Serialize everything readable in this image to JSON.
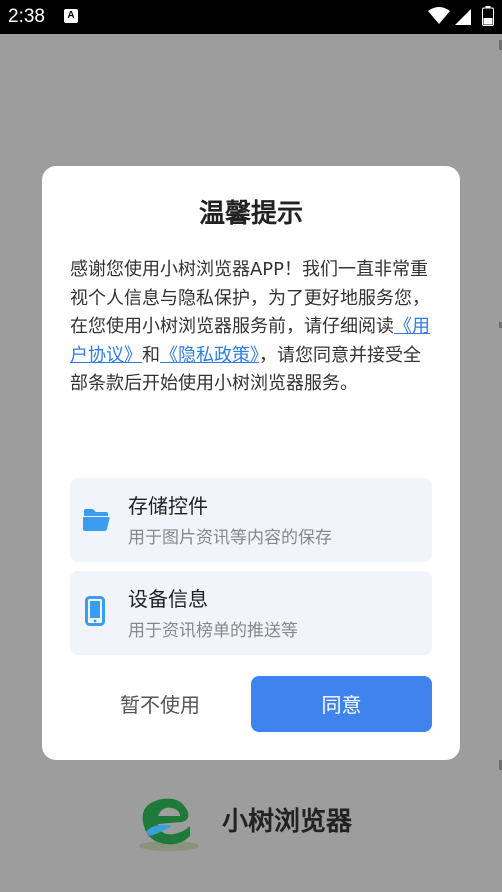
{
  "status_bar": {
    "time": "2:38",
    "notification_icon": "a-icon",
    "icons": [
      "wifi-icon",
      "signal-icon",
      "battery-icon"
    ]
  },
  "dialog": {
    "title": "温馨提示",
    "body": {
      "text_before": "感谢您使用小树浏览器APP！我们一直非常重视个人信息与隐私保护，为了更好地服务您，在您使用小树浏览器服务前，请仔细阅读",
      "link_user_agreement": "《用户协议》",
      "text_and": "和",
      "link_privacy_policy": "《隐私政策》",
      "text_after": "，请您同意并接受全部条款后开始使用小树浏览器服务。"
    },
    "permissions": [
      {
        "icon": "folder-icon",
        "title": "存储控件",
        "description": "用于图片资讯等内容的保存"
      },
      {
        "icon": "phone-icon",
        "title": "设备信息",
        "description": "用于资讯榜单的推送等"
      }
    ],
    "decline_label": "暂不使用",
    "agree_label": "同意"
  },
  "brand": {
    "logo_icon": "e-logo-icon",
    "name": "小树浏览器"
  },
  "colors": {
    "accent": "#3f84ee",
    "link": "#2f7de1",
    "card_bg": "#f1f5fb",
    "icon_blue": "#3b9cf0",
    "backdrop": "#9d9d9d"
  }
}
